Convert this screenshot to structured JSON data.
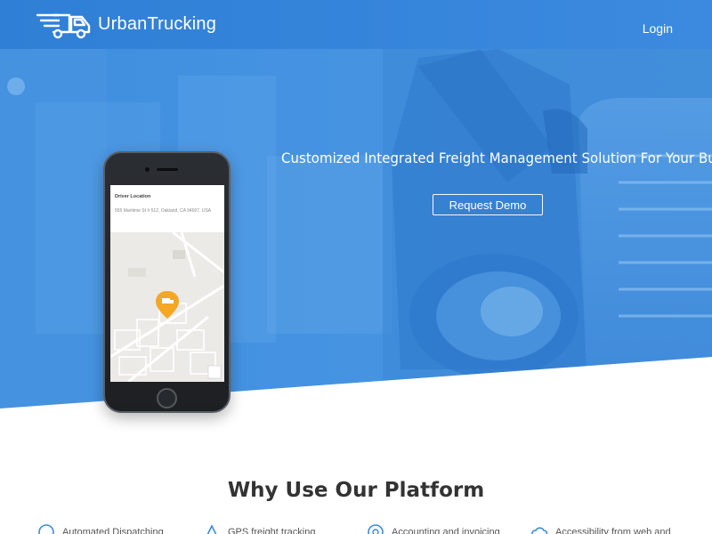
{
  "header": {
    "brand_name": "UrbanTrucking",
    "login_label": "Login"
  },
  "hero": {
    "tagline": "Customized Integrated Freight Management Solution For Your Business",
    "cta_label": "Request Demo"
  },
  "phone": {
    "screen_title": "Driver Location",
    "address": "555 Maritime St # 512, Oakland, CA 94607, USA"
  },
  "section": {
    "title": "Why Use Our Platform"
  },
  "features": [
    {
      "label": "Automated Dispatching",
      "icon": "dispatch-icon"
    },
    {
      "label": "GPS freight tracking",
      "icon": "gps-icon"
    },
    {
      "label": "Accounting and invoicing",
      "icon": "accounting-icon"
    },
    {
      "label": "Accessibility from web and",
      "icon": "cloud-icon"
    }
  ],
  "colors": {
    "brand_blue": "#2f7fd6",
    "hero_blue": "#3383d8",
    "accent_orange": "#f5a623",
    "text_dark": "#333333"
  }
}
